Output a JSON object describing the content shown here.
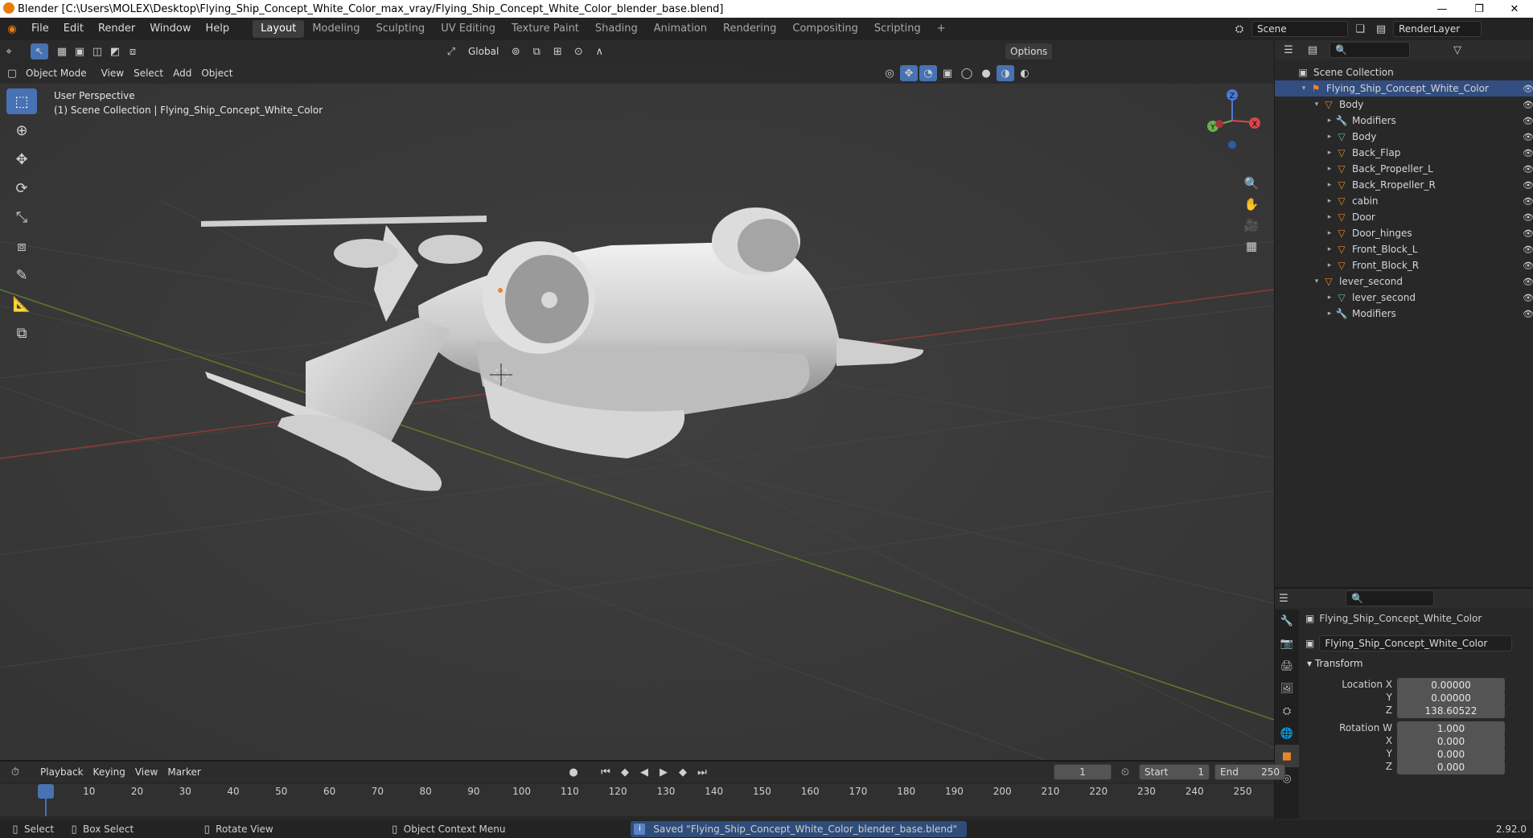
{
  "window": {
    "title": "Blender [C:\\Users\\MOLEX\\Desktop\\Flying_Ship_Concept_White_Color_max_vray/Flying_Ship_Concept_White_Color_blender_base.blend]",
    "minimize": "—",
    "maximize": "❐",
    "close": "✕"
  },
  "menu": [
    "File",
    "Edit",
    "Render",
    "Window",
    "Help"
  ],
  "workspaces": [
    "Layout",
    "Modeling",
    "Sculpting",
    "UV Editing",
    "Texture Paint",
    "Shading",
    "Animation",
    "Rendering",
    "Compositing",
    "Scripting"
  ],
  "active_workspace": "Layout",
  "add_workspace": "+",
  "scene": {
    "name": "Scene",
    "render_layer": "RenderLayer"
  },
  "viewport": {
    "transform_orientation": "Global",
    "options_label": "Options",
    "mode": "Object Mode",
    "header_menu": [
      "View",
      "Select",
      "Add",
      "Object"
    ],
    "perspective": "User Perspective",
    "collection_info": "(1) Scene Collection | Flying_Ship_Concept_White_Color",
    "gizmo": {
      "z": "Z",
      "y": "Y",
      "x": "X"
    }
  },
  "outliner": {
    "rows": [
      {
        "label": "Scene Collection",
        "indent": 0,
        "icon": "collection-icon",
        "expanded": ""
      },
      {
        "label": "Flying_Ship_Concept_White_Color",
        "indent": 1,
        "icon": "object-icon",
        "expanded": "▾",
        "selected": true
      },
      {
        "label": "Body",
        "indent": 2,
        "icon": "mesh-object-icon",
        "expanded": "▾"
      },
      {
        "label": "Modifiers",
        "indent": 3,
        "icon": "wrench-icon",
        "expanded": "▸"
      },
      {
        "label": "Body",
        "indent": 3,
        "icon": "mesh-data-icon",
        "expanded": "▸"
      },
      {
        "label": "Back_Flap",
        "indent": 3,
        "icon": "mesh-object-icon",
        "expanded": "▸"
      },
      {
        "label": "Back_Propeller_L",
        "indent": 3,
        "icon": "mesh-object-icon",
        "expanded": "▸"
      },
      {
        "label": "Back_Rropeller_R",
        "indent": 3,
        "icon": "mesh-object-icon",
        "expanded": "▸"
      },
      {
        "label": "cabin",
        "indent": 3,
        "icon": "mesh-object-icon",
        "expanded": "▸"
      },
      {
        "label": "Door",
        "indent": 3,
        "icon": "mesh-object-icon",
        "expanded": "▸"
      },
      {
        "label": "Door_hinges",
        "indent": 3,
        "icon": "mesh-object-icon",
        "expanded": "▸"
      },
      {
        "label": "Front_Block_L",
        "indent": 3,
        "icon": "mesh-object-icon",
        "expanded": "▸"
      },
      {
        "label": "Front_Block_R",
        "indent": 3,
        "icon": "mesh-object-icon",
        "expanded": "▸"
      },
      {
        "label": "lever_second",
        "indent": 2,
        "icon": "mesh-object-icon",
        "expanded": "▾"
      },
      {
        "label": "lever_second",
        "indent": 3,
        "icon": "mesh-data-icon",
        "expanded": "▸"
      },
      {
        "label": "Modifiers",
        "indent": 3,
        "icon": "wrench-icon",
        "expanded": "▸"
      }
    ]
  },
  "properties": {
    "object_name": "Flying_Ship_Concept_White_Color",
    "object_field": "Flying_Ship_Concept_White_Color",
    "section": "Transform",
    "location": {
      "label": "Location X",
      "x": "0.00000",
      "y_label": "Y",
      "y": "0.00000",
      "z_label": "Z",
      "z": "138.60522"
    },
    "rotation": {
      "label": "Rotation W",
      "w": "1.000",
      "x_label": "X",
      "x": "0.000",
      "y_label": "Y",
      "y": "0.000",
      "z_label": "Z",
      "z": "0.000"
    }
  },
  "timeline": {
    "menu": [
      "Playback",
      "Keying",
      "View",
      "Marker"
    ],
    "current_frame": "1",
    "start_label": "Start",
    "start": "1",
    "end_label": "End",
    "end": "250",
    "ticks": [
      "1",
      "10",
      "20",
      "30",
      "40",
      "50",
      "60",
      "70",
      "80",
      "90",
      "100",
      "110",
      "120",
      "130",
      "140",
      "150",
      "160",
      "170",
      "180",
      "190",
      "200",
      "210",
      "220",
      "230",
      "240",
      "250"
    ]
  },
  "status": {
    "select": "Select",
    "box_select": "Box Select",
    "rotate_view": "Rotate View",
    "context_menu": "Object Context Menu",
    "message": "Saved \"Flying_Ship_Concept_White_Color_blender_base.blend\"",
    "version": "2.92.0"
  },
  "colors": {
    "accent": "#4772b3",
    "selection": "#334d80",
    "object_orange": "#e8862b",
    "mesh_green": "#5fc08c"
  }
}
